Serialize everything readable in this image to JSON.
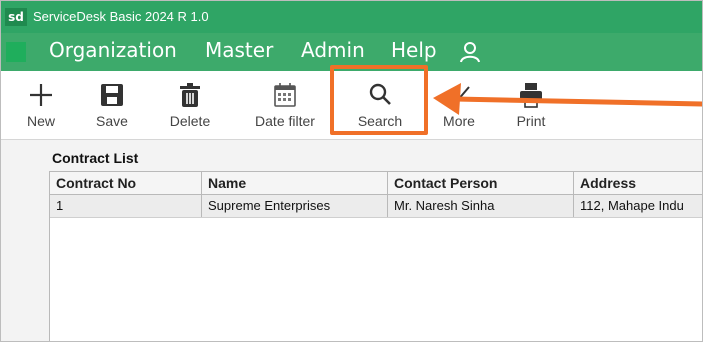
{
  "window": {
    "logo_text": "sd",
    "title": "ServiceDesk Basic 2024 R 1.0"
  },
  "menu": {
    "items": [
      "Organization",
      "Master",
      "Admin",
      "Help"
    ],
    "user_icon": "user-icon"
  },
  "toolbar": {
    "tools": [
      {
        "label": "New",
        "icon": "plus-icon"
      },
      {
        "label": "Save",
        "icon": "save-icon"
      },
      {
        "label": "Delete",
        "icon": "trash-icon"
      },
      {
        "label": "Date filter",
        "icon": "calendar-icon"
      },
      {
        "label": "Search",
        "icon": "search-icon"
      },
      {
        "label": "More",
        "icon": "check-icon"
      },
      {
        "label": "Print",
        "icon": "printer-icon"
      }
    ]
  },
  "annotation": {
    "highlight_color": "#f07028"
  },
  "contract_list": {
    "title": "Contract List",
    "columns": [
      "Contract No",
      "Name",
      "Contact Person",
      "Address"
    ],
    "rows": [
      [
        "1",
        "Supreme Enterprises",
        "Mr. Naresh Sinha",
        "112, Mahape Indu"
      ]
    ]
  },
  "colors": {
    "title_bar": "#2fa565",
    "menu_bar": "#3daa6b",
    "accent_orange": "#f07028"
  }
}
